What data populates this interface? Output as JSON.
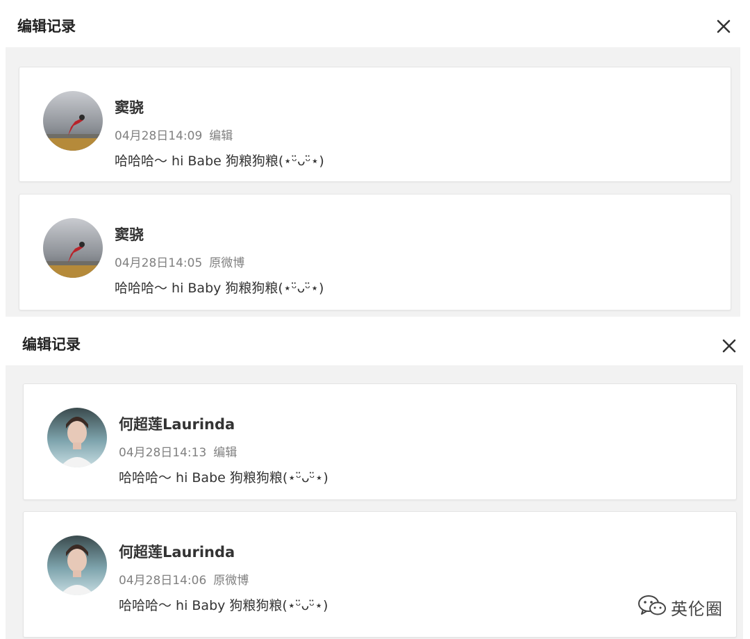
{
  "panels": [
    {
      "title": "编辑记录",
      "records": [
        {
          "user": "窦骁",
          "time": "04月28日14:09",
          "type": "编辑",
          "text": "哈哈哈～ hi Babe 狗粮狗粮(⋆ᵕ̈ᴗᵕ̈⋆)"
        },
        {
          "user": "窦骁",
          "time": "04月28日14:05",
          "type": "原微博",
          "text": "哈哈哈～ hi Baby 狗粮狗粮(⋆ᵕ̈ᴗᵕ̈⋆)"
        }
      ]
    },
    {
      "title": "编辑记录",
      "records": [
        {
          "user": "何超莲Laurinda",
          "time": "04月28日14:13",
          "type": "编辑",
          "text": "哈哈哈～ hi Babe 狗粮狗粮(⋆ᵕ̈ᴗᵕ̈⋆)"
        },
        {
          "user": "何超莲Laurinda",
          "time": "04月28日14:06",
          "type": "原微博",
          "text": "哈哈哈～ hi Baby 狗粮狗粮(⋆ᵕ̈ᴗᵕ̈⋆)"
        }
      ]
    }
  ],
  "watermark": {
    "text": "英伦圈",
    "icon": "wechat-icon"
  },
  "icons": {
    "close": "close-icon",
    "avatar": "avatar"
  },
  "colors": {
    "body_bg": "#f2f2f2",
    "meta_text": "#808080",
    "title_text": "#222222"
  }
}
